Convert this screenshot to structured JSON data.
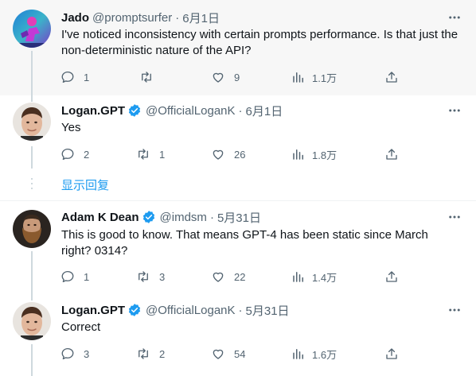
{
  "tweets": [
    {
      "name": "Jado",
      "handle": "@promptsurfer",
      "sep": "·",
      "date": "6月1日",
      "verified": false,
      "text": "I've noticed inconsistency with certain prompts performance. Is that just the non-deterministic nature of the API?",
      "replies": "1",
      "retweets": "",
      "likes": "9",
      "views": "1.1万"
    },
    {
      "name": "Logan.GPT",
      "handle": "@OfficialLoganK",
      "sep": "·",
      "date": "6月1日",
      "verified": true,
      "text": "Yes",
      "replies": "2",
      "retweets": "1",
      "likes": "26",
      "views": "1.8万"
    },
    {
      "name": "Adam K Dean",
      "handle": "@imdsm",
      "sep": "·",
      "date": "5月31日",
      "verified": true,
      "text": "This is good to know. That means GPT-4 has been static since March right? 0314?",
      "replies": "1",
      "retweets": "3",
      "likes": "22",
      "views": "1.4万"
    },
    {
      "name": "Logan.GPT",
      "handle": "@OfficialLoganK",
      "sep": "·",
      "date": "5月31日",
      "verified": true,
      "text": "Correct",
      "replies": "3",
      "retweets": "2",
      "likes": "54",
      "views": "1.6万"
    }
  ],
  "show_replies": "显示回复",
  "colors": {
    "accent": "#1d9bf0",
    "verified": "#1d9bf0",
    "secondary_text": "#536471",
    "thread_line": "#cfd9de",
    "hover_bg": "#f7f7f7"
  },
  "icons": [
    "more-icon",
    "reply-icon",
    "retweet-icon",
    "like-icon",
    "views-icon",
    "share-icon",
    "verified-badge-icon"
  ]
}
